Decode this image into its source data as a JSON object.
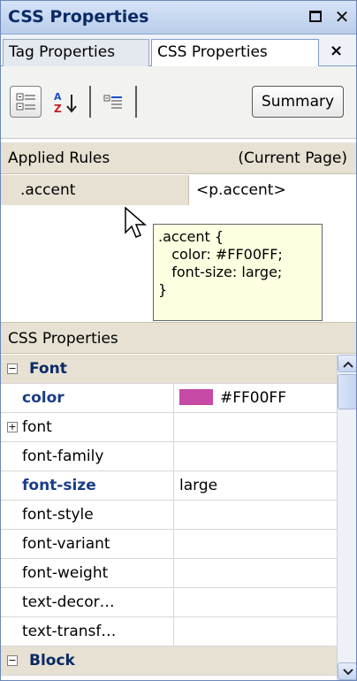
{
  "window": {
    "title": "CSS Properties",
    "maximize_icon": "maximize-icon",
    "close_icon": "close-icon"
  },
  "tabs": [
    {
      "label": "Tag Properties",
      "active": false
    },
    {
      "label": "CSS Properties",
      "active": true
    }
  ],
  "tab_close": "×",
  "toolbar": {
    "buttons": [
      {
        "name": "show-category-view-button",
        "icon": "category-list-icon"
      },
      {
        "name": "show-alphabetical-view-button",
        "icon": "sort-az-icon"
      },
      {
        "name": "show-set-properties-button",
        "icon": "set-properties-icon"
      }
    ],
    "summary_label": "Summary"
  },
  "applied_rules": {
    "header_left": "Applied Rules",
    "header_right": "(Current Page)",
    "rule_selector": ".accent",
    "rule_tag": "<p.accent>"
  },
  "tooltip": {
    "text": ".accent {\n   color: #FF00FF;\n   font-size: large;\n}"
  },
  "css_properties": {
    "header": "CSS Properties",
    "rows": [
      {
        "type": "category",
        "name": "Font",
        "expander": "−"
      },
      {
        "type": "prop",
        "name": "color",
        "value": "#FF00FF",
        "set": true,
        "swatch": "#c64aa6"
      },
      {
        "type": "prop",
        "name": "font",
        "value": "",
        "expander": "+"
      },
      {
        "type": "prop",
        "name": "font-family",
        "value": ""
      },
      {
        "type": "prop",
        "name": "font-size",
        "value": "large",
        "set": true
      },
      {
        "type": "prop",
        "name": "font-style",
        "value": ""
      },
      {
        "type": "prop",
        "name": "font-variant",
        "value": ""
      },
      {
        "type": "prop",
        "name": "font-weight",
        "value": ""
      },
      {
        "type": "prop",
        "name": "text-decor…",
        "value": ""
      },
      {
        "type": "prop",
        "name": "text-transf…",
        "value": ""
      },
      {
        "type": "category",
        "name": "Block",
        "expander": "−"
      }
    ]
  },
  "colors": {
    "accent_swatch": "#c64aa6",
    "header_bg": "#e6e1d2",
    "title_text": "#0a2a66"
  }
}
